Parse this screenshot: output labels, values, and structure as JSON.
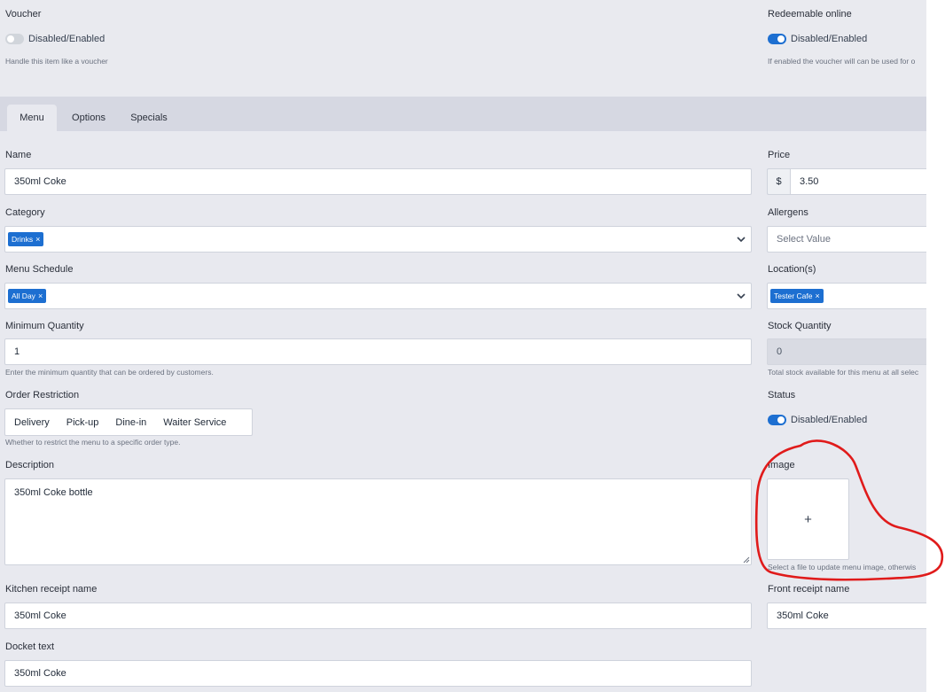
{
  "voucher": {
    "label": "Voucher",
    "toggle_text": "Disabled/Enabled",
    "help": "Handle this item like a voucher",
    "enabled": false
  },
  "redeemable": {
    "label": "Redeemable online",
    "toggle_text": "Disabled/Enabled",
    "help": "If enabled the voucher will can be used for o",
    "enabled": true
  },
  "tabs": [
    {
      "label": "Menu",
      "active": true
    },
    {
      "label": "Options",
      "active": false
    },
    {
      "label": "Specials",
      "active": false
    }
  ],
  "name": {
    "label": "Name",
    "value": "350ml Coke"
  },
  "price": {
    "label": "Price",
    "prefix": "$",
    "value": "3.50"
  },
  "category": {
    "label": "Category",
    "chip": "Drinks"
  },
  "allergens": {
    "label": "Allergens",
    "placeholder": "Select Value"
  },
  "menu_schedule": {
    "label": "Menu Schedule",
    "chip": "All Day"
  },
  "locations": {
    "label": "Location(s)",
    "chip": "Tester Cafe"
  },
  "minimum_quantity": {
    "label": "Minimum Quantity",
    "value": "1",
    "help": "Enter the minimum quantity that can be ordered by customers."
  },
  "stock_quantity": {
    "label": "Stock Quantity",
    "value": "0",
    "help": "Total stock available for this menu at all selec"
  },
  "order_restriction": {
    "label": "Order Restriction",
    "options": [
      "Delivery",
      "Pick-up",
      "Dine-in",
      "Waiter Service"
    ],
    "help": "Whether to restrict the menu to a specific order type."
  },
  "status": {
    "label": "Status",
    "toggle_text": "Disabled/Enabled",
    "enabled": true
  },
  "description": {
    "label": "Description",
    "value": "350ml Coke bottle"
  },
  "image": {
    "label": "Image",
    "add_symbol": "+",
    "help": "Select a file to update menu image, otherwis"
  },
  "kitchen_receipt_name": {
    "label": "Kitchen receipt name",
    "value": "350ml Coke"
  },
  "front_receipt_name": {
    "label": "Front receipt name",
    "value": "350ml Coke"
  },
  "docket_text": {
    "label": "Docket text",
    "value": "350ml Coke"
  },
  "colors": {
    "accent": "#1d6fd1",
    "annotation": "#e01b1b"
  }
}
